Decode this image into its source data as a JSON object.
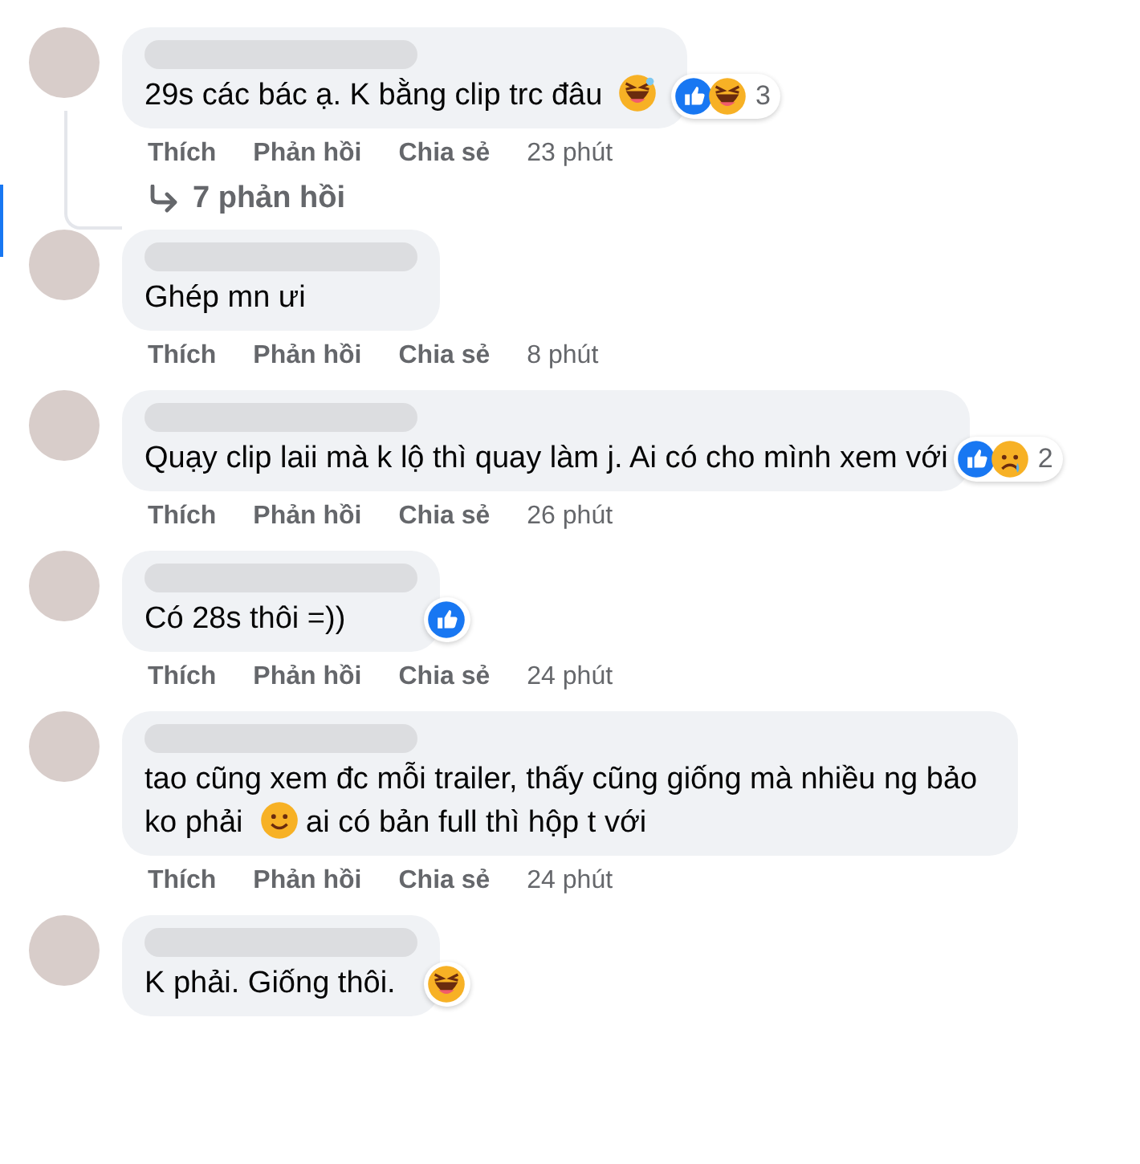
{
  "comments": [
    {
      "parts": [
        {
          "kind": "text",
          "text": "29s các bác ạ. K bằng clip trc đâu"
        },
        {
          "kind": "emoji-sweat-smile"
        }
      ],
      "reactions": [
        {
          "kind": "like"
        },
        {
          "kind": "haha"
        }
      ],
      "reaction_count": "3",
      "actions": [
        "Thích",
        "Phản hồi",
        "Chia sẻ"
      ],
      "time": "23 phút",
      "replies": {
        "label": "7 phản hồi"
      }
    },
    {
      "parts": [
        {
          "kind": "text",
          "text": "Ghép mn ưi"
        }
      ],
      "actions": [
        "Thích",
        "Phản hồi",
        "Chia sẻ"
      ],
      "time": "8 phút"
    },
    {
      "parts": [
        {
          "kind": "text",
          "text": "Quạy clip laii mà k lộ thì quay làm j. Ai có cho mình xem với"
        }
      ],
      "reactions": [
        {
          "kind": "like"
        },
        {
          "kind": "sad"
        }
      ],
      "reaction_count": "2",
      "actions": [
        "Thích",
        "Phản hồi",
        "Chia sẻ"
      ],
      "time": "26 phút"
    },
    {
      "parts": [
        {
          "kind": "text",
          "text": "Có 28s thôi =))"
        }
      ],
      "reactions": [
        {
          "kind": "like"
        }
      ],
      "actions": [
        "Thích",
        "Phản hồi",
        "Chia sẻ"
      ],
      "time": "24 phút"
    },
    {
      "parts": [
        {
          "kind": "text",
          "text": "tao cũng xem đc mỗi trailer, thấy cũng giống mà nhiều ng bảo ko phải"
        },
        {
          "kind": "emoji-smile"
        },
        {
          "kind": "text",
          "text": "ai có bản full thì hộp t với"
        }
      ],
      "actions": [
        "Thích",
        "Phản hồi",
        "Chia sẻ"
      ],
      "time": "24 phút"
    },
    {
      "parts": [
        {
          "kind": "text",
          "text": "K phải. Giống thôi."
        }
      ],
      "reactions": [
        {
          "kind": "haha"
        }
      ]
    }
  ]
}
